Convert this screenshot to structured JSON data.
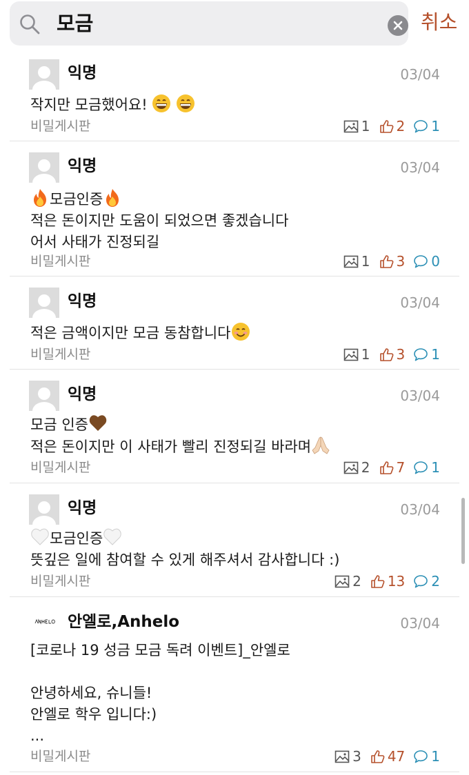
{
  "search": {
    "query": "모금",
    "cancel_label": "취소"
  },
  "posts": [
    {
      "author": "익명",
      "date": "03/04",
      "line1": "작지만 모금했어요! ",
      "board": "비밀게시판",
      "images": "1",
      "likes": "2",
      "comments": "1"
    },
    {
      "author": "익명",
      "date": "03/04",
      "line1_text": "모금인증",
      "line2": "적은 돈이지만 도움이 되었으면 좋겠습니다",
      "line3": "어서 사태가 진정되길",
      "board": "비밀게시판",
      "images": "1",
      "likes": "3",
      "comments": "0"
    },
    {
      "author": "익명",
      "date": "03/04",
      "line1": "적은 금액이지만 모금 동참합니다",
      "board": "비밀게시판",
      "images": "1",
      "likes": "3",
      "comments": "1"
    },
    {
      "author": "익명",
      "date": "03/04",
      "line1": "모금 인증",
      "line2": "적은 돈이지만 이 사태가 빨리 진정되길 바라며",
      "board": "비밀게시판",
      "images": "2",
      "likes": "7",
      "comments": "1"
    },
    {
      "author": "익명",
      "date": "03/04",
      "line1_text": "모금인증",
      "line2": "뜻깊은 일에 참여할 수 있게 해주셔서 감사합니다 :)",
      "board": "비밀게시판",
      "images": "2",
      "likes": "13",
      "comments": "2"
    },
    {
      "author": "안엘로,Anhelo",
      "date": "03/04",
      "line1": "[코로나 19 성금 모금 독려 이벤트]_안엘로",
      "line2": "안녕하세요, 슈니들!",
      "line3": "안엘로 학우 입니다:)",
      "line4": "...",
      "board": "비밀게시판",
      "images": "3",
      "likes": "47",
      "comments": "1"
    }
  ],
  "colors": {
    "accent": "#b5502b",
    "comment": "#2b8fb5",
    "meta": "#8a8a8a"
  }
}
